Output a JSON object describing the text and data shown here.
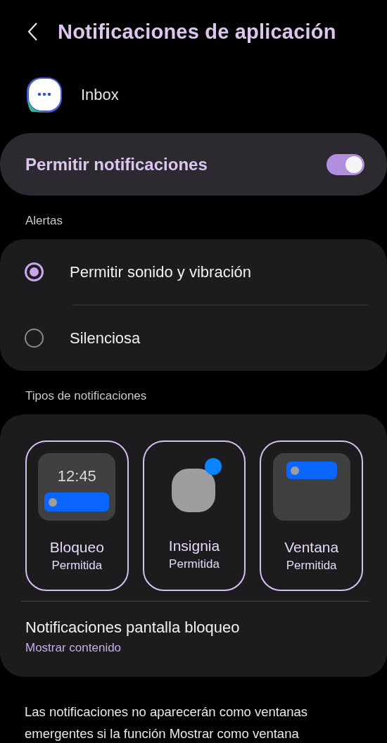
{
  "header": {
    "title": "Notificaciones de aplicación"
  },
  "app": {
    "name": "Inbox"
  },
  "master": {
    "label": "Permitir notificaciones",
    "on": true
  },
  "alerts": {
    "heading": "Alertas",
    "options": [
      {
        "label": "Permitir sonido y vibración",
        "selected": true
      },
      {
        "label": "Silenciosa",
        "selected": false
      }
    ]
  },
  "types": {
    "heading": "Tipos de notificaciones",
    "items": [
      {
        "kind": "lock",
        "preview_time": "12:45",
        "label": "Bloqueo",
        "status": "Permitida",
        "selected": true
      },
      {
        "kind": "badge",
        "label": "Insignia",
        "status": "Permitida",
        "selected": true
      },
      {
        "kind": "popup",
        "label": "Ventana",
        "status": "Permitida",
        "selected": true
      }
    ],
    "lock_screen": {
      "title": "Notificaciones pantalla bloqueo",
      "value": "Mostrar contenido"
    }
  },
  "footer": {
    "text": "Las notificaciones no aparecerán como ventanas emergentes si la función Mostrar como ventana"
  }
}
